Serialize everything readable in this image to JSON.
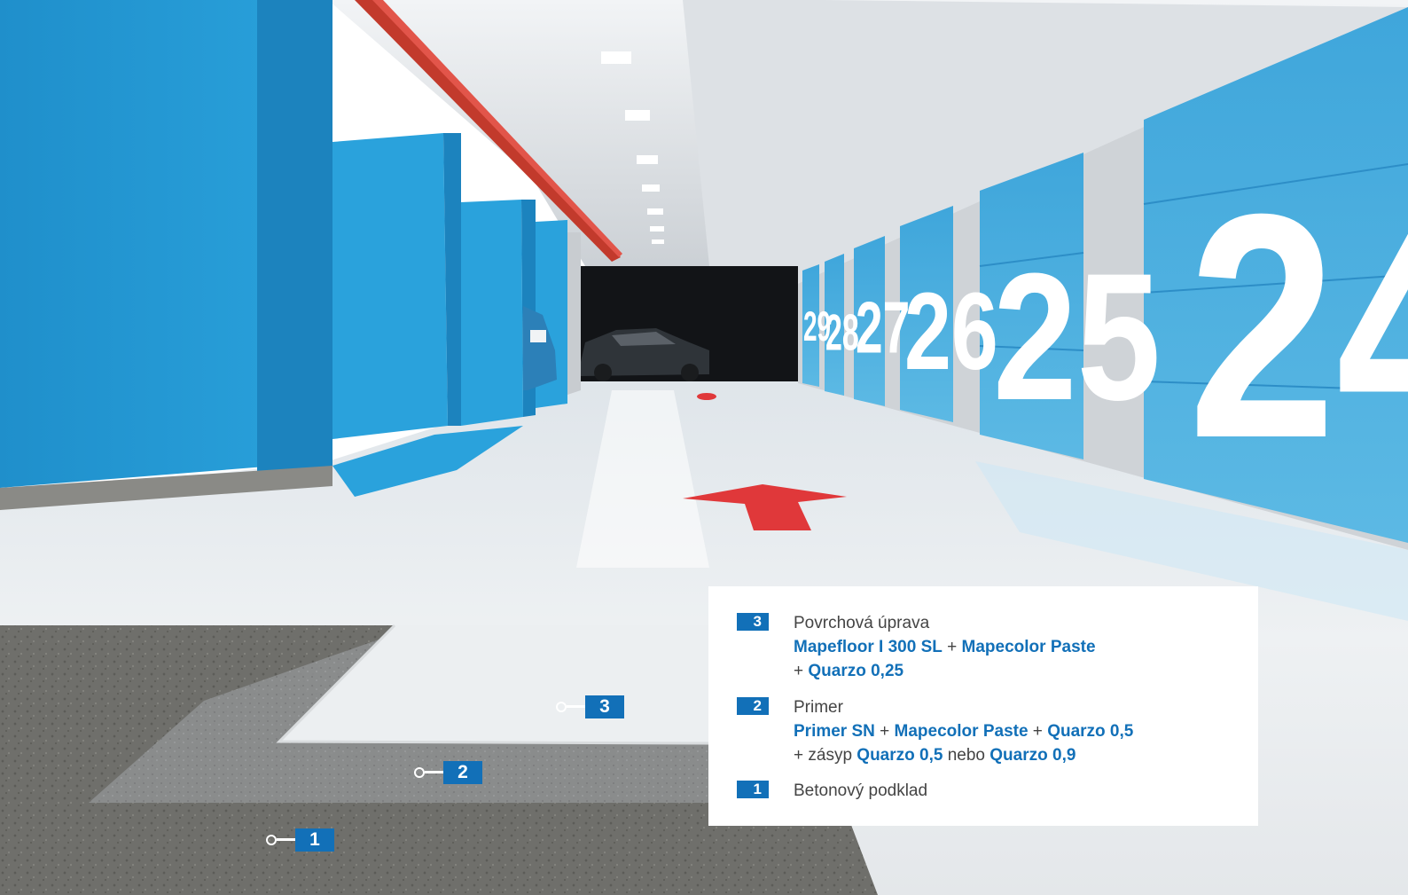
{
  "scene": {
    "door_numbers": [
      "24",
      "25",
      "26",
      "27",
      "28",
      "29"
    ],
    "colors": {
      "brand_blue": "#1270b8",
      "pillar_blue": "#2a9fd8",
      "door_blue": "#4ab0e0",
      "arrow_red": "#e0383a",
      "floor": "#eaeef1",
      "concrete": "#6d6d69"
    }
  },
  "markers": [
    {
      "num": "3"
    },
    {
      "num": "2"
    },
    {
      "num": "1"
    }
  ],
  "legend": {
    "items": [
      {
        "num": "3",
        "title": "Povrchová úprava",
        "p1": "Mapefloor I 300 SL",
        "s1": " + ",
        "p2": "Mapecolor Paste",
        "s2": "+ ",
        "p3": "Quarzo 0,25"
      },
      {
        "num": "2",
        "title": "Primer",
        "p1": "Primer SN",
        "s1": " + ",
        "p2": "Mapecolor Paste",
        "s2": " + ",
        "p3": "Quarzo 0,5",
        "s3": "+ zásyp ",
        "p4": "Quarzo 0,5",
        "s4": " nebo ",
        "p5": "Quarzo 0,9"
      },
      {
        "num": "1",
        "title": "Betonový podklad"
      }
    ]
  }
}
